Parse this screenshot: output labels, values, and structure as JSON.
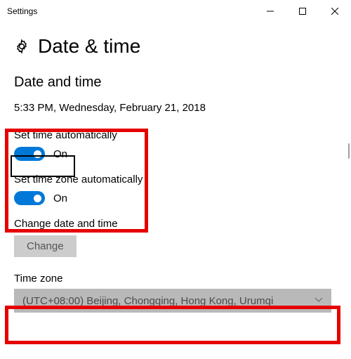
{
  "window": {
    "title": "Settings"
  },
  "page": {
    "title": "Date & time"
  },
  "section": {
    "heading": "Date and time"
  },
  "datetime": {
    "now": "5:33 PM, Wednesday, February 21, 2018"
  },
  "set_time_auto": {
    "label": "Set time automatically",
    "state": "On"
  },
  "set_tz_auto": {
    "label": "Set time zone automatically",
    "state": "On"
  },
  "change": {
    "label": "Change date and time",
    "button": "Change"
  },
  "timezone": {
    "label": "Time zone",
    "selected": "(UTC+08:00) Beijing, Chongqing, Hong Kong, Urumqi"
  }
}
